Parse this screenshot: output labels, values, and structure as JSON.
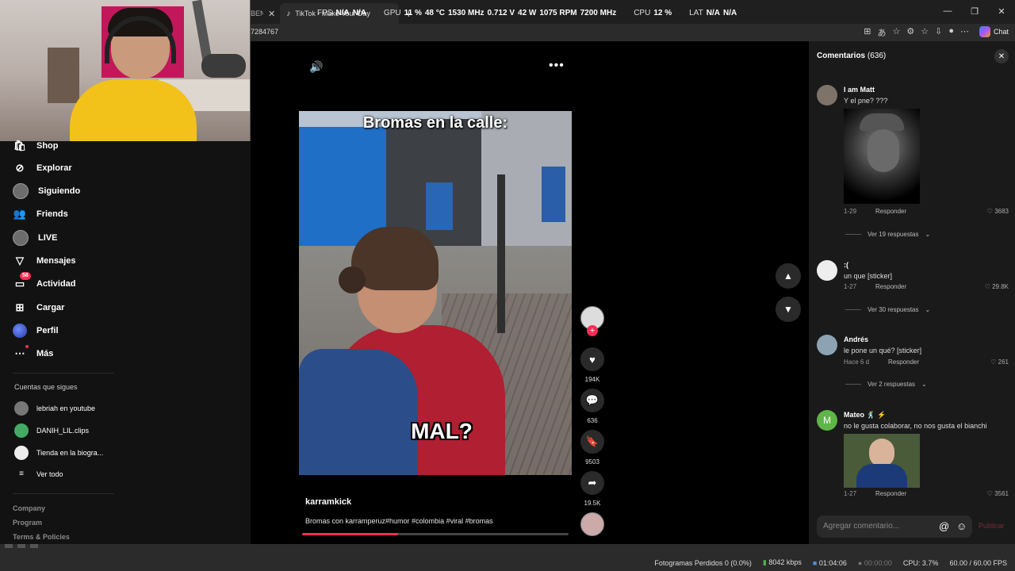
{
  "browser": {
    "prev_tab_stub": "BEN",
    "active_tab_title": "TikTok - Make Your Day",
    "url_partial": "7284767",
    "chat_label": "Chat"
  },
  "overlay": {
    "fps_label": "FPS",
    "fps_val1": "N/A",
    "fps_val2": "N/A",
    "gpu_label": "GPU",
    "gpu_load": "11 %",
    "gpu_temp": "48 °C",
    "gpu_clock": "1530 MHz",
    "gpu_volt": "0.712 V",
    "gpu_power": "42 W",
    "gpu_fan": "1075 RPM",
    "gpu_mem": "7200 MHz",
    "cpu_label": "CPU",
    "cpu_load": "12 %",
    "lat_label": "LAT",
    "lat_val1": "N/A",
    "lat_val2": "N/A"
  },
  "sidebar": {
    "items": [
      {
        "label": "Shop"
      },
      {
        "label": "Explorar"
      },
      {
        "label": "Siguiendo"
      },
      {
        "label": "Friends"
      },
      {
        "label": "LIVE"
      },
      {
        "label": "Mensajes"
      },
      {
        "label": "Actividad",
        "badge": "58"
      },
      {
        "label": "Cargar"
      },
      {
        "label": "Perfil"
      },
      {
        "label": "Más"
      }
    ],
    "following_title": "Cuentas que sigues",
    "following": [
      {
        "name": "lebriah en youtube"
      },
      {
        "name": "DANIH_LIL.clips"
      },
      {
        "name": "Tienda en la biogra..."
      }
    ],
    "see_all": "Ver todo",
    "footer": [
      "Company",
      "Program",
      "Terms & Policies"
    ]
  },
  "video": {
    "title_overlay": "Bromas en la calle:",
    "caption_overlay": "MAL?",
    "author": "karramkick",
    "description": "Bromas con karramperuz#humor #colombia #viral #bromas",
    "progress": 0.36,
    "likes": "194K",
    "comments": "636",
    "saves": "9503",
    "shares": "19.5K"
  },
  "comments_panel": {
    "title": "Comentarios",
    "count": "(636)",
    "items": [
      {
        "name": "I am Matt",
        "text": "Y el pne? ???",
        "date": "1-29",
        "reply": "Responder",
        "likes": "3683",
        "more": "Ver 19 respuestas"
      },
      {
        "name": ":(",
        "text": "un que [sticker]",
        "date": "1-27",
        "reply": "Responder",
        "likes": "29.8K",
        "more": "Ver 30 respuestas"
      },
      {
        "name": "Andrés",
        "text": "le pone un qué? [sticker]",
        "date": "Hace 6 d",
        "reply": "Responder",
        "likes": "261",
        "more": "Ver 2 respuestas"
      },
      {
        "name": "Mateo 🕺 ⚡",
        "text": "no le gusta colaborar, no nos gusta el bianchi",
        "date": "1-27",
        "reply": "Responder",
        "likes": "3561",
        "avatar_letter": "M"
      }
    ],
    "input_placeholder": "Agregar comentario...",
    "post_label": "Publicar"
  },
  "status": {
    "dropped": "Fotogramas Perdidos 0 (0.0%)",
    "bitrate": "8042 kbps",
    "rec_time": "01:04:06",
    "stream_time": "00:00:00",
    "cpu": "CPU: 3.7%",
    "fps": "60.00 / 60.00 FPS"
  },
  "colors": {
    "accent": "#fe2c55",
    "panel": "#1a1a1a",
    "sidebar": "#121212"
  }
}
